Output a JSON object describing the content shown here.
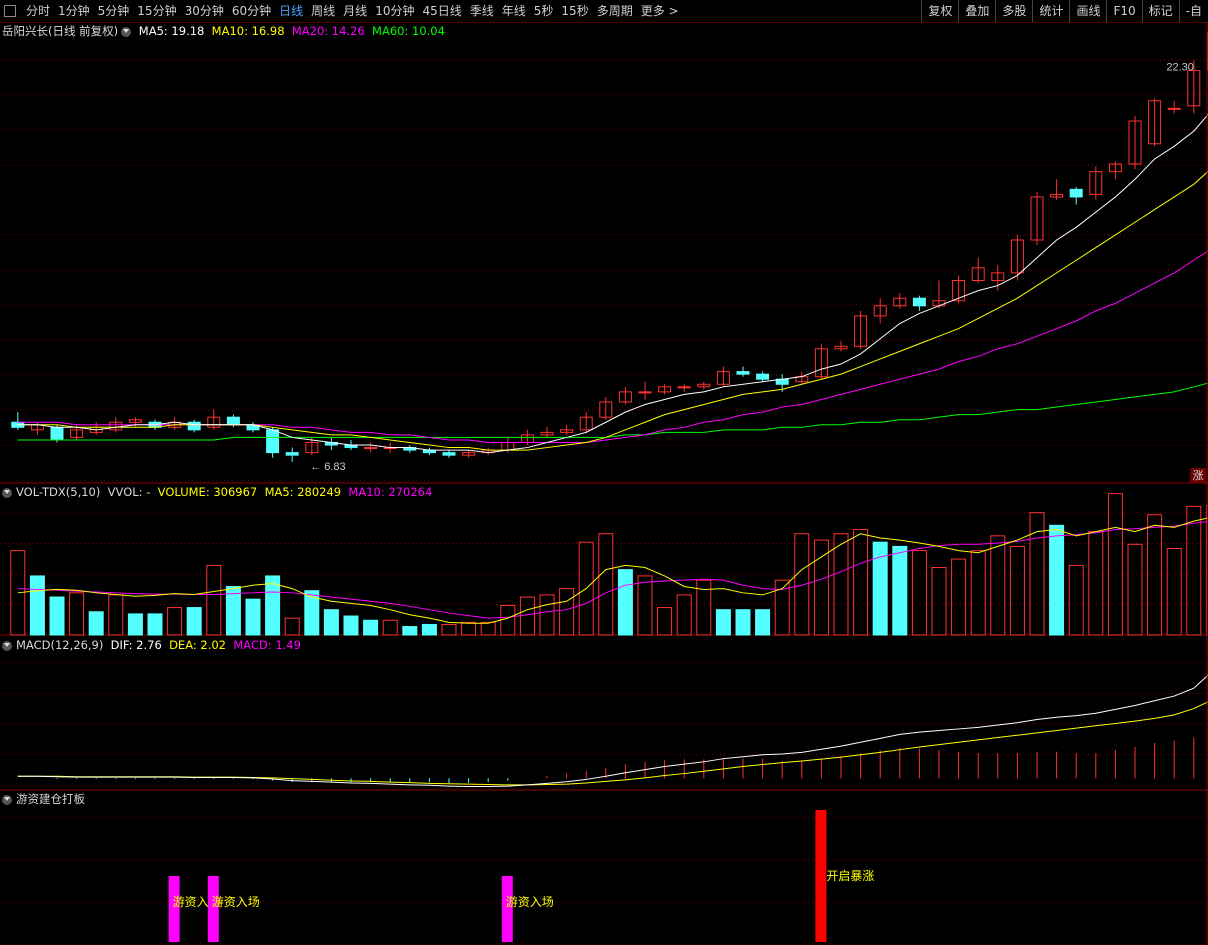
{
  "toolbar": {
    "items": [
      "分时",
      "1分钟",
      "5分钟",
      "15分钟",
      "30分钟",
      "60分钟",
      "日线",
      "周线",
      "月线",
      "10分钟",
      "45日线",
      "季线",
      "年线",
      "5秒",
      "15秒",
      "多周期",
      "更多 >"
    ],
    "active_index": 6,
    "right_items": [
      "复权",
      "叠加",
      "多股",
      "统计",
      "画线",
      "F10",
      "标记",
      "-自"
    ]
  },
  "main_panel": {
    "title": "岳阳兴长(日线 前复权)",
    "ma5": "MA5: 19.18",
    "ma10": "MA10: 16.98",
    "ma20": "MA20: 14.26",
    "ma60": "MA60: 10.04",
    "high_label": "22.30",
    "low_label": "6.83",
    "corner_badge": "涨"
  },
  "vol_panel": {
    "name": "VOL-TDX(5,10)",
    "vvol": "VVOL: -",
    "volume": "VOLUME: 306967",
    "ma5": "MA5: 280249",
    "ma10": "MA10: 270264"
  },
  "macd_panel": {
    "name": "MACD(12,26,9)",
    "dif": "DIF: 2.76",
    "dea": "DEA: 2.02",
    "macd": "MACD: 1.49"
  },
  "signal_panel": {
    "name": "游资建仓打板",
    "labels": [
      "游资入场",
      "游资入场",
      "游资入场",
      "开启暴涨"
    ]
  },
  "colors": {
    "up": "#ff3232",
    "down": "#54ffff",
    "ma5": "#ffffff",
    "ma10": "#ffff00",
    "ma20": "#ff00ff",
    "ma60": "#00ff00",
    "grid": "#7a0000",
    "signal_magenta": "#ff00ff",
    "signal_red": "#ff0000"
  },
  "chart_data": [
    {
      "type": "candlestick",
      "title": "岳阳兴长(日线 前复权)",
      "y_range": [
        6.0,
        23.5
      ],
      "annotations": [
        {
          "label": "22.30",
          "kind": "high"
        },
        {
          "label": "6.83",
          "kind": "low"
        }
      ],
      "candles": [
        [
          8.4,
          8.2,
          8.8,
          8.1
        ],
        [
          8.1,
          8.3,
          8.4,
          7.9
        ],
        [
          8.2,
          7.7,
          8.3,
          7.6
        ],
        [
          7.8,
          8.1,
          8.3,
          7.7
        ],
        [
          8.0,
          8.2,
          8.4,
          7.9
        ],
        [
          8.1,
          8.4,
          8.6,
          8.0
        ],
        [
          8.4,
          8.5,
          8.6,
          8.2
        ],
        [
          8.4,
          8.2,
          8.5,
          8.1
        ],
        [
          8.2,
          8.4,
          8.6,
          8.1
        ],
        [
          8.4,
          8.1,
          8.5,
          8.0
        ],
        [
          8.2,
          8.6,
          8.9,
          8.1
        ],
        [
          8.6,
          8.3,
          8.7,
          8.2
        ],
        [
          8.3,
          8.1,
          8.4,
          8.0
        ],
        [
          8.1,
          7.2,
          8.2,
          7.0
        ],
        [
          7.2,
          7.1,
          7.4,
          6.83
        ],
        [
          7.2,
          7.6,
          7.8,
          7.1
        ],
        [
          7.6,
          7.5,
          7.8,
          7.3
        ],
        [
          7.5,
          7.4,
          7.7,
          7.3
        ],
        [
          7.4,
          7.4,
          7.6,
          7.2
        ],
        [
          7.4,
          7.4,
          7.6,
          7.2
        ],
        [
          7.4,
          7.3,
          7.5,
          7.2
        ],
        [
          7.3,
          7.2,
          7.4,
          7.1
        ],
        [
          7.2,
          7.1,
          7.3,
          7.0
        ],
        [
          7.1,
          7.2,
          7.3,
          7.0
        ],
        [
          7.2,
          7.3,
          7.4,
          7.1
        ],
        [
          7.3,
          7.6,
          7.8,
          7.2
        ],
        [
          7.6,
          7.9,
          8.1,
          7.5
        ],
        [
          7.9,
          8.0,
          8.2,
          7.8
        ],
        [
          8.0,
          8.1,
          8.3,
          7.9
        ],
        [
          8.1,
          8.6,
          8.8,
          8.0
        ],
        [
          8.6,
          9.2,
          9.4,
          8.5
        ],
        [
          9.2,
          9.6,
          9.8,
          9.1
        ],
        [
          9.6,
          9.6,
          10.0,
          9.3
        ],
        [
          9.6,
          9.8,
          9.9,
          9.5
        ],
        [
          9.8,
          9.8,
          9.9,
          9.6
        ],
        [
          9.8,
          9.9,
          10.0,
          9.7
        ],
        [
          9.9,
          10.4,
          10.6,
          9.8
        ],
        [
          10.4,
          10.3,
          10.6,
          10.2
        ],
        [
          10.3,
          10.1,
          10.4,
          10.0
        ],
        [
          10.1,
          9.9,
          10.3,
          9.6
        ],
        [
          10.0,
          10.2,
          10.4,
          9.9
        ],
        [
          10.2,
          11.3,
          11.5,
          10.1
        ],
        [
          11.3,
          11.4,
          11.6,
          11.2
        ],
        [
          11.4,
          12.6,
          12.8,
          11.3
        ],
        [
          12.6,
          13.0,
          13.3,
          12.3
        ],
        [
          13.0,
          13.3,
          13.5,
          12.9
        ],
        [
          13.3,
          13.0,
          13.4,
          12.8
        ],
        [
          13.0,
          13.2,
          14.0,
          12.9
        ],
        [
          13.2,
          14.0,
          14.2,
          13.1
        ],
        [
          14.0,
          14.5,
          14.9,
          13.9
        ],
        [
          14.0,
          14.3,
          14.6,
          13.6
        ],
        [
          14.3,
          15.6,
          15.8,
          14.0
        ],
        [
          15.6,
          17.3,
          17.5,
          15.4
        ],
        [
          17.3,
          17.4,
          18.0,
          17.2
        ],
        [
          17.6,
          17.3,
          17.7,
          17.0
        ],
        [
          17.4,
          18.3,
          18.5,
          17.2
        ],
        [
          18.3,
          18.6,
          18.7,
          18.0
        ],
        [
          18.6,
          20.3,
          20.5,
          18.4
        ],
        [
          19.4,
          21.1,
          21.2,
          19.3
        ],
        [
          20.8,
          20.8,
          21.1,
          20.6
        ],
        [
          20.9,
          22.3,
          22.7,
          20.6
        ],
        [
          22.3,
          23.8,
          23.9,
          21.5
        ]
      ],
      "ma5": [
        8.3,
        8.3,
        8.2,
        8.2,
        8.1,
        8.2,
        8.3,
        8.3,
        8.4,
        8.3,
        8.3,
        8.3,
        8.3,
        8.1,
        7.8,
        7.7,
        7.6,
        7.5,
        7.5,
        7.4,
        7.4,
        7.3,
        7.3,
        7.3,
        7.2,
        7.3,
        7.4,
        7.6,
        7.8,
        8.0,
        8.4,
        8.8,
        9.1,
        9.3,
        9.5,
        9.6,
        9.8,
        9.9,
        10.0,
        10.1,
        10.2,
        10.5,
        10.7,
        11.1,
        11.7,
        12.3,
        12.7,
        13.0,
        13.3,
        13.6,
        13.8,
        14.2,
        14.9,
        15.6,
        16.1,
        16.7,
        17.3,
        18.0,
        18.8,
        19.3,
        19.9,
        20.8
      ],
      "ma10": [
        8.3,
        8.3,
        8.3,
        8.2,
        8.2,
        8.2,
        8.2,
        8.2,
        8.3,
        8.3,
        8.3,
        8.3,
        8.3,
        8.2,
        8.1,
        8.0,
        7.9,
        7.9,
        7.8,
        7.7,
        7.6,
        7.5,
        7.4,
        7.4,
        7.3,
        7.3,
        7.3,
        7.4,
        7.5,
        7.6,
        7.8,
        8.1,
        8.4,
        8.7,
        8.9,
        9.1,
        9.3,
        9.5,
        9.6,
        9.7,
        9.9,
        10.1,
        10.3,
        10.6,
        10.9,
        11.2,
        11.5,
        11.8,
        12.1,
        12.5,
        12.9,
        13.3,
        13.8,
        14.3,
        14.8,
        15.3,
        15.8,
        16.3,
        16.8,
        17.3,
        17.8,
        18.5
      ],
      "ma20": [
        8.4,
        8.4,
        8.4,
        8.3,
        8.3,
        8.3,
        8.3,
        8.3,
        8.3,
        8.3,
        8.3,
        8.3,
        8.3,
        8.3,
        8.2,
        8.2,
        8.1,
        8.0,
        8.0,
        7.9,
        7.9,
        7.8,
        7.7,
        7.7,
        7.6,
        7.6,
        7.6,
        7.6,
        7.6,
        7.6,
        7.7,
        7.8,
        7.9,
        8.1,
        8.2,
        8.4,
        8.5,
        8.7,
        8.8,
        9.0,
        9.1,
        9.3,
        9.5,
        9.7,
        9.9,
        10.1,
        10.3,
        10.5,
        10.8,
        11.0,
        11.3,
        11.5,
        11.8,
        12.1,
        12.4,
        12.8,
        13.1,
        13.5,
        13.9,
        14.3,
        14.8,
        15.3
      ],
      "ma60": [
        7.7,
        7.7,
        7.7,
        7.7,
        7.7,
        7.7,
        7.7,
        7.7,
        7.7,
        7.7,
        7.7,
        7.8,
        7.8,
        7.8,
        7.8,
        7.8,
        7.8,
        7.8,
        7.8,
        7.8,
        7.8,
        7.8,
        7.8,
        7.8,
        7.8,
        7.8,
        7.8,
        7.8,
        7.8,
        7.8,
        7.8,
        7.9,
        7.9,
        8.0,
        8.0,
        8.0,
        8.1,
        8.1,
        8.1,
        8.2,
        8.2,
        8.3,
        8.3,
        8.4,
        8.4,
        8.5,
        8.5,
        8.6,
        8.7,
        8.7,
        8.8,
        8.9,
        8.9,
        9.0,
        9.1,
        9.2,
        9.3,
        9.4,
        9.5,
        9.6,
        9.8,
        10.0
      ]
    },
    {
      "type": "bar",
      "title": "VOL-TDX(5,10)",
      "y_range": [
        0,
        320000
      ],
      "volume": [
        200000,
        140000,
        90000,
        100000,
        55000,
        95000,
        50000,
        50000,
        65000,
        65000,
        165000,
        115000,
        85000,
        140000,
        40000,
        105000,
        60000,
        45000,
        35000,
        35000,
        20000,
        25000,
        25000,
        30000,
        30000,
        70000,
        90000,
        95000,
        110000,
        220000,
        240000,
        155000,
        140000,
        65000,
        95000,
        130000,
        60000,
        60000,
        60000,
        130000,
        240000,
        225000,
        240000,
        250000,
        220000,
        210000,
        200000,
        160000,
        180000,
        200000,
        235000,
        210000,
        290000,
        260000,
        165000,
        245000,
        335000,
        215000,
        285000,
        205000,
        305000,
        307000
      ],
      "down_flags": [
        0,
        1,
        1,
        0,
        1,
        0,
        1,
        1,
        0,
        1,
        0,
        1,
        1,
        1,
        0,
        1,
        1,
        1,
        1,
        0,
        1,
        1,
        0,
        0,
        0,
        0,
        0,
        0,
        0,
        0,
        0,
        1,
        0,
        0,
        0,
        0,
        1,
        1,
        1,
        0,
        0,
        0,
        0,
        0,
        1,
        1,
        0,
        0,
        0,
        0,
        0,
        0,
        0,
        1,
        0,
        0,
        0,
        0,
        0,
        0,
        0,
        0
      ],
      "ma5": [
        100000,
        105000,
        108000,
        106000,
        100000,
        96000,
        92000,
        94000,
        98000,
        96000,
        103000,
        110000,
        118000,
        122000,
        110000,
        90000,
        80000,
        75000,
        70000,
        60000,
        48000,
        40000,
        30000,
        28000,
        28000,
        40000,
        60000,
        72000,
        80000,
        110000,
        155000,
        165000,
        160000,
        140000,
        115000,
        108000,
        110000,
        100000,
        95000,
        110000,
        155000,
        185000,
        215000,
        240000,
        230000,
        225000,
        218000,
        210000,
        200000,
        195000,
        210000,
        225000,
        245000,
        250000,
        235000,
        245000,
        255000,
        245000,
        260000,
        255000,
        270000,
        280000
      ],
      "ma10": [
        110000,
        108000,
        106000,
        104000,
        102000,
        100000,
        98000,
        97000,
        97000,
        96000,
        96000,
        98000,
        100000,
        102000,
        100000,
        95000,
        90000,
        85000,
        80000,
        75000,
        68000,
        60000,
        52000,
        46000,
        40000,
        42000,
        48000,
        55000,
        60000,
        75000,
        100000,
        118000,
        125000,
        128000,
        130000,
        132000,
        130000,
        118000,
        110000,
        108000,
        118000,
        132000,
        150000,
        170000,
        185000,
        195000,
        205000,
        212000,
        215000,
        215000,
        218000,
        222000,
        230000,
        235000,
        238000,
        242000,
        250000,
        252000,
        255000,
        258000,
        265000,
        270000
      ]
    },
    {
      "type": "line",
      "title": "MACD(12,26,9)",
      "y_range": [
        -0.3,
        3.2
      ],
      "dif": [
        0.05,
        0.05,
        0.04,
        0.03,
        0.03,
        0.03,
        0.03,
        0.03,
        0.03,
        0.02,
        0.02,
        0.02,
        0.01,
        -0.02,
        -0.06,
        -0.08,
        -0.1,
        -0.12,
        -0.13,
        -0.15,
        -0.17,
        -0.18,
        -0.2,
        -0.21,
        -0.21,
        -0.2,
        -0.17,
        -0.13,
        -0.09,
        -0.03,
        0.05,
        0.14,
        0.22,
        0.3,
        0.36,
        0.42,
        0.5,
        0.55,
        0.6,
        0.62,
        0.66,
        0.74,
        0.82,
        0.92,
        1.02,
        1.12,
        1.18,
        1.22,
        1.26,
        1.3,
        1.36,
        1.42,
        1.5,
        1.56,
        1.6,
        1.66,
        1.76,
        1.86,
        1.98,
        2.1,
        2.3,
        2.76
      ],
      "dea": [
        0.05,
        0.05,
        0.05,
        0.04,
        0.04,
        0.04,
        0.04,
        0.04,
        0.04,
        0.03,
        0.03,
        0.03,
        0.02,
        0.01,
        -0.01,
        -0.03,
        -0.05,
        -0.07,
        -0.08,
        -0.1,
        -0.11,
        -0.13,
        -0.14,
        -0.15,
        -0.16,
        -0.17,
        -0.17,
        -0.16,
        -0.15,
        -0.12,
        -0.08,
        -0.04,
        0.01,
        0.07,
        0.12,
        0.18,
        0.24,
        0.3,
        0.35,
        0.4,
        0.44,
        0.49,
        0.54,
        0.6,
        0.66,
        0.73,
        0.8,
        0.86,
        0.92,
        0.98,
        1.04,
        1.1,
        1.16,
        1.22,
        1.28,
        1.34,
        1.4,
        1.46,
        1.53,
        1.62,
        1.78,
        2.02
      ]
    },
    {
      "type": "bar",
      "title": "游资建仓打板",
      "signals": [
        {
          "index": 8,
          "label": "游资入场",
          "kind": "entry"
        },
        {
          "index": 10,
          "label": "游资入场",
          "kind": "entry"
        },
        {
          "index": 25,
          "label": "游资入场",
          "kind": "entry"
        },
        {
          "index": 41,
          "label": "开启暴涨",
          "kind": "surge"
        }
      ]
    }
  ]
}
